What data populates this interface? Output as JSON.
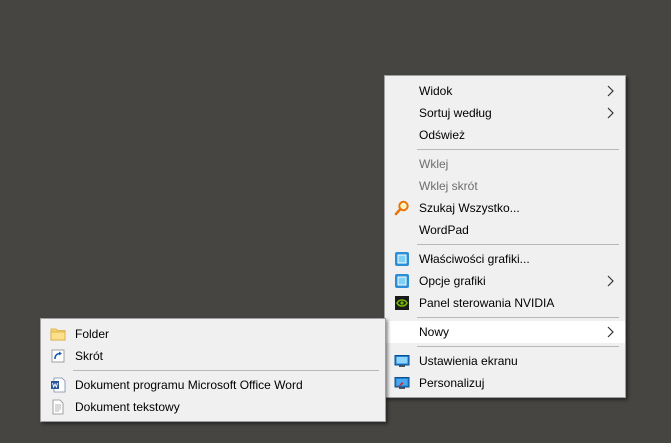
{
  "main_menu": {
    "items": [
      {
        "label": "Widok"
      },
      {
        "label": "Sortuj według"
      },
      {
        "label": "Odśwież"
      },
      {
        "label": "Wklej"
      },
      {
        "label": "Wklej skrót"
      },
      {
        "label": "Szukaj Wszystko..."
      },
      {
        "label": "WordPad"
      },
      {
        "label": "Właściwości grafiki..."
      },
      {
        "label": "Opcje grafiki"
      },
      {
        "label": "Panel sterowania NVIDIA"
      },
      {
        "label": "Nowy"
      },
      {
        "label": "Ustawienia ekranu"
      },
      {
        "label": "Personalizuj"
      }
    ]
  },
  "sub_menu": {
    "items": [
      {
        "label": "Folder"
      },
      {
        "label": "Skrót"
      },
      {
        "label": "Dokument programu Microsoft Office Word"
      },
      {
        "label": "Dokument tekstowy"
      }
    ]
  },
  "colors": {
    "desktop": "#474542",
    "menu_bg": "#f0f0f0",
    "highlight": "#ffffff",
    "disabled_text": "#6d6d6d"
  }
}
